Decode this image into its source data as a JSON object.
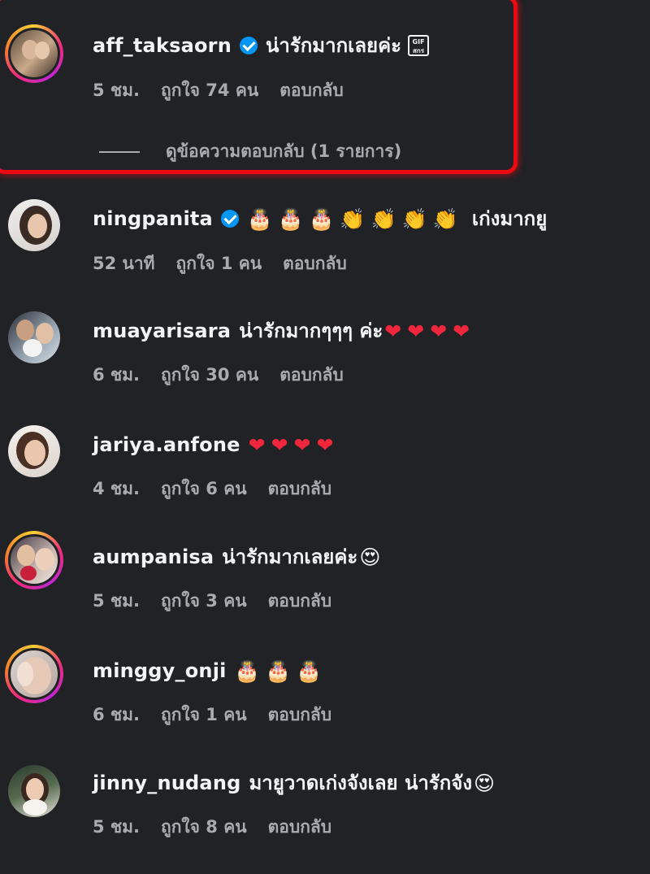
{
  "comments": [
    {
      "username": "aff_taksaorn",
      "verified": true,
      "text": "น่ารักมากเลยค่ะ",
      "emojis": [],
      "badge": "GIF\nสกร",
      "time": "5 ชม.",
      "likes": "ถูกใจ 74 คน",
      "reply": "ตอบกลับ",
      "view_replies": "ดูข้อความตอบกลับ (1 รายการ)"
    },
    {
      "username": "ningpanita",
      "verified": true,
      "text": "เก่งมากยู",
      "emojis": [
        "🎂",
        "🎂",
        "🎂",
        "👏",
        "👏",
        "👏",
        "👏"
      ],
      "time": "52 นาที",
      "likes": "ถูกใจ 1 คน",
      "reply": "ตอบกลับ"
    },
    {
      "username": "muayarisara",
      "verified": false,
      "text": "น่ารักมากๆๆๆ ค่ะ",
      "emojis": [
        "❤",
        "❤",
        "❤",
        "❤"
      ],
      "time": "6 ชม.",
      "likes": "ถูกใจ 30 คน",
      "reply": "ตอบกลับ"
    },
    {
      "username": "jariya.anfone",
      "verified": false,
      "text": "",
      "emojis": [
        "❤",
        "❤",
        "❤",
        "❤"
      ],
      "time": "4 ชม.",
      "likes": "ถูกใจ 6 คน",
      "reply": "ตอบกลับ"
    },
    {
      "username": "aumpanisa",
      "verified": false,
      "text": "น่ารักมากเลยค่ะ",
      "emojis": [
        "😍"
      ],
      "time": "5 ชม.",
      "likes": "ถูกใจ 3 คน",
      "reply": "ตอบกลับ"
    },
    {
      "username": "minggy_onji",
      "verified": false,
      "text": "",
      "emojis": [
        "🎂",
        "🎂",
        "🎂"
      ],
      "time": "6 ชม.",
      "likes": "ถูกใจ 1 คน",
      "reply": "ตอบกลับ"
    },
    {
      "username": "jinny_nudang",
      "verified": false,
      "text": "มายูวาดเก่งจังเลย น่ารักจัง",
      "emojis": [
        "😍"
      ],
      "time": "5 ชม.",
      "likes": "ถูกใจ 8 คน",
      "reply": "ตอบกลับ"
    }
  ],
  "colors": {
    "background": "#202226",
    "highlight": "#ec0a12",
    "verified": "#0095f6",
    "meta_text": "#a9abb1"
  }
}
